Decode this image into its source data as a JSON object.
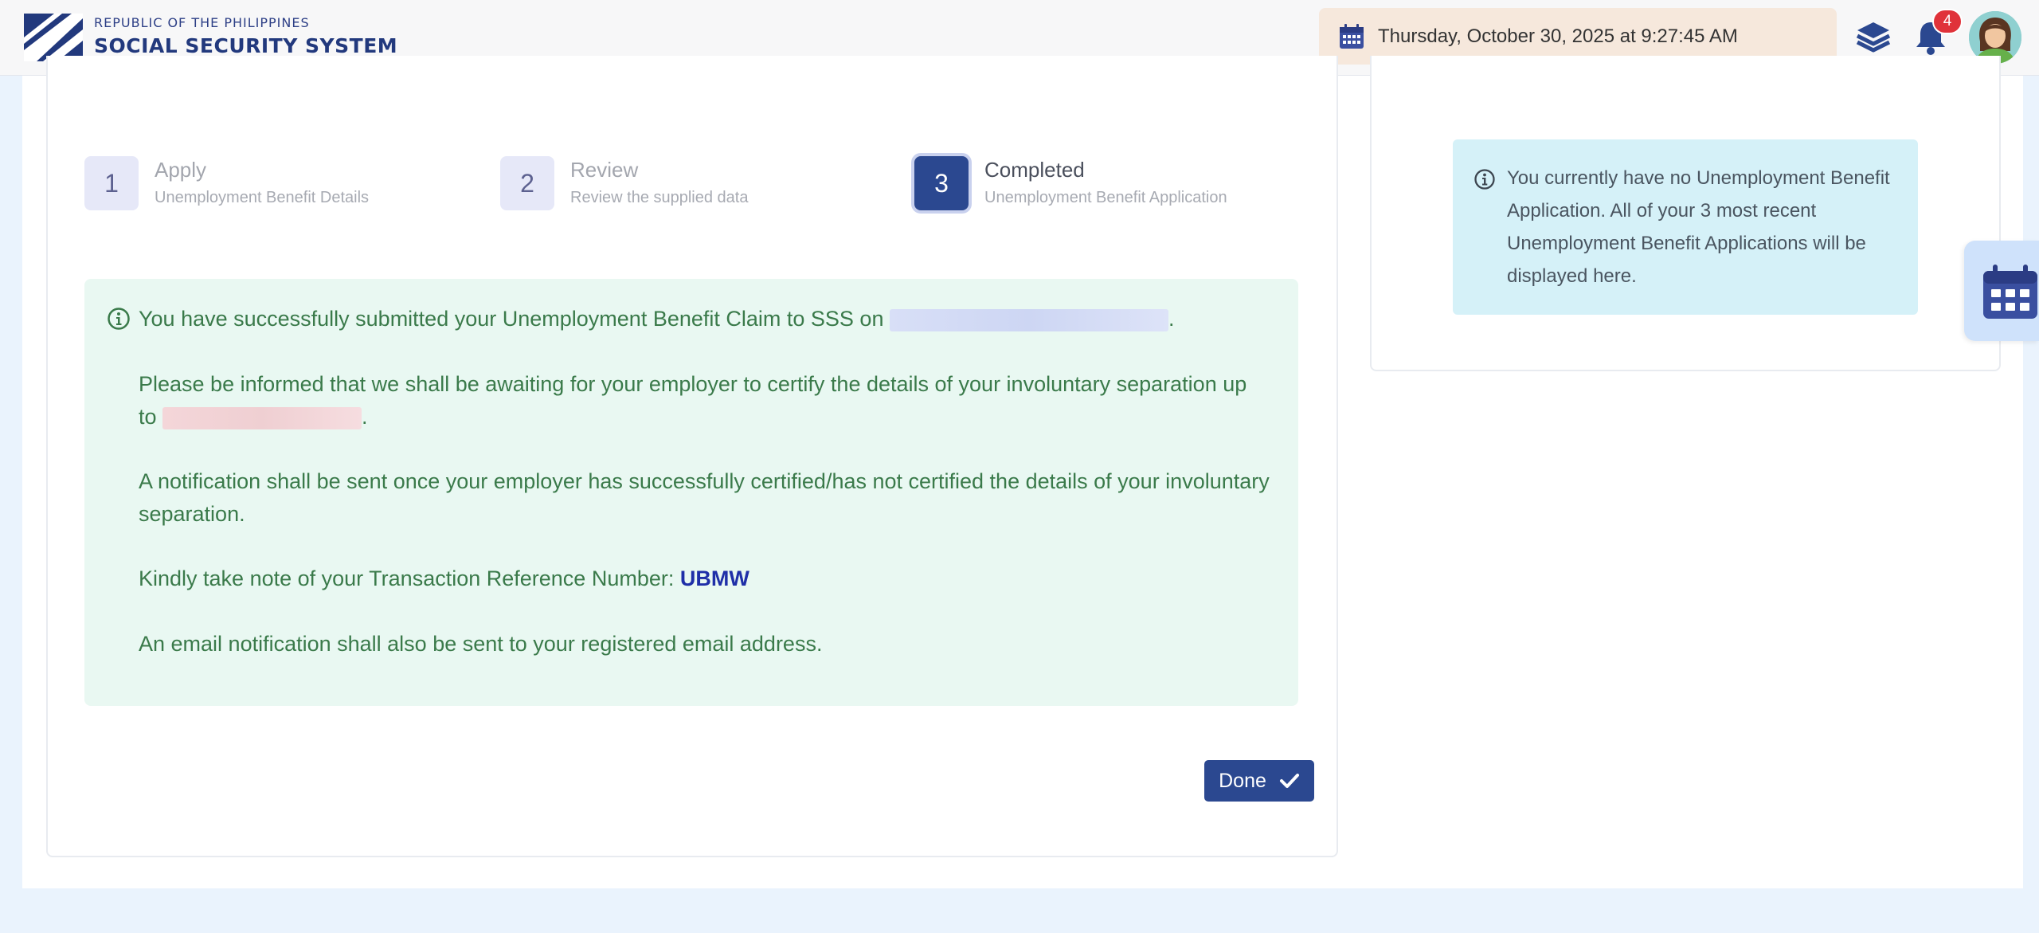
{
  "header": {
    "logo_small": "REPUBLIC OF THE PHILIPPINES",
    "logo_big": "SOCIAL SECURITY SYSTEM",
    "datetime": "Thursday, October 30, 2025 at 9:27:45 AM",
    "notification_count": "4",
    "icons": [
      "calendar-icon",
      "layers-icon",
      "bell-icon",
      "avatar"
    ]
  },
  "steps": [
    {
      "number": "1",
      "title": "Apply",
      "subtitle": "Unemployment Benefit Details"
    },
    {
      "number": "2",
      "title": "Review",
      "subtitle": "Review the supplied data"
    },
    {
      "number": "3",
      "title": "Completed",
      "subtitle": "Unemployment Benefit Application"
    }
  ],
  "success": {
    "line1_prefix": "You have successfully submitted your Unemployment Benefit Claim to SSS on",
    "line1_suffix": ".",
    "line2_prefix": "Please be informed that we shall be awaiting for your employer to certify the details of your involuntary separation up to",
    "line2_suffix": ".",
    "line3": "A notification shall be sent once your employer has successfully certified/has not certified the details of your involuntary separation.",
    "line4_prefix": "Kindly take note of your Transaction Reference Number:",
    "reference_number": "UBMW",
    "line5": "An email notification shall also be sent to your registered email address."
  },
  "done_button": {
    "label": "Done"
  },
  "sidebar_info": {
    "text": "You currently have no Unemployment Benefit Application. All of your 3 most recent Unemployment Benefit Applications will be displayed here."
  },
  "colors": {
    "primary": "#2b4890",
    "success_bg": "#e9f8f2",
    "success_text": "#3a7a4a",
    "info_bg": "#d5f1f8",
    "badge": "#e0323a",
    "date_bg": "#f6e8dc"
  }
}
